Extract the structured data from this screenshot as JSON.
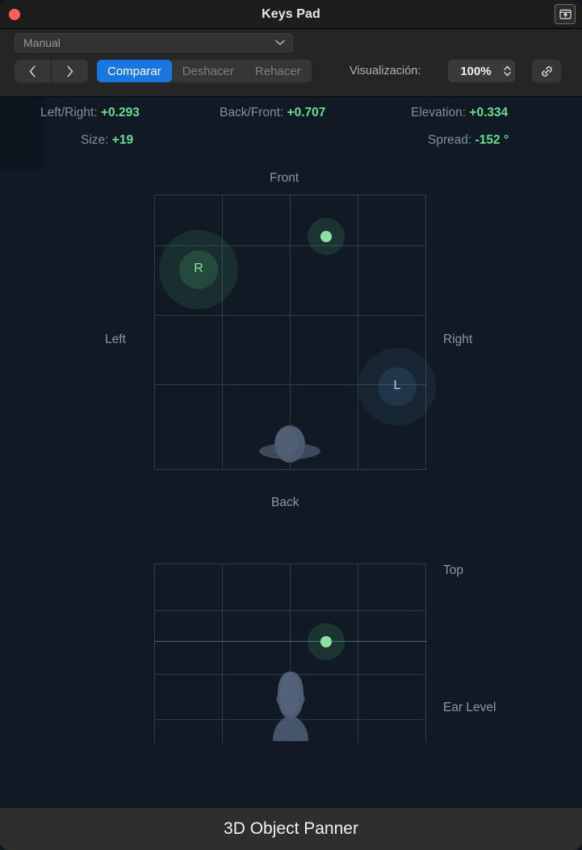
{
  "window": {
    "title": "Keys Pad",
    "close_icon": "close-dot-icon",
    "share_icon": "export-up-arrow-icon"
  },
  "toolbar": {
    "preset": {
      "value": "Manual",
      "chevron_icon": "chevron-down-icon"
    },
    "nav": {
      "prev_icon": "chevron-left-icon",
      "next_icon": "chevron-right-icon"
    },
    "compare_label": "Comparar",
    "undo_label": "Deshacer",
    "redo_label": "Rehacer",
    "view_label": "Visualización:",
    "zoom_value": "100%",
    "stepper_icon": "stepper-updown-icon",
    "link_icon": "link-chain-icon",
    "accent_color": "#1877e0"
  },
  "readouts": [
    {
      "key": "Left/Right:",
      "value": "+0.293"
    },
    {
      "key": "Back/Front:",
      "value": "+0.707"
    },
    {
      "key": "Elevation:",
      "value": "+0.334"
    },
    {
      "key": "Size:",
      "value": "+19"
    },
    {
      "key": "Spread:",
      "value": "-152 °"
    }
  ],
  "value_color": "#63e08d",
  "top_view": {
    "label_front": "Front",
    "label_back": "Back",
    "label_left": "Left",
    "label_right": "Right",
    "markers": [
      {
        "label": "R",
        "color": "green"
      },
      {
        "label": "L",
        "color": "blue"
      }
    ],
    "source_dot": "source-position-dot",
    "listener_icon": "listener-head-top-icon"
  },
  "elevation_view": {
    "label_top": "Top",
    "label_ear": "Ear Level",
    "source_dot": "source-position-dot",
    "listener_icon": "listener-head-front-icon",
    "ear_line": "ear-level-line"
  },
  "footer": {
    "title": "3D Object Panner"
  }
}
